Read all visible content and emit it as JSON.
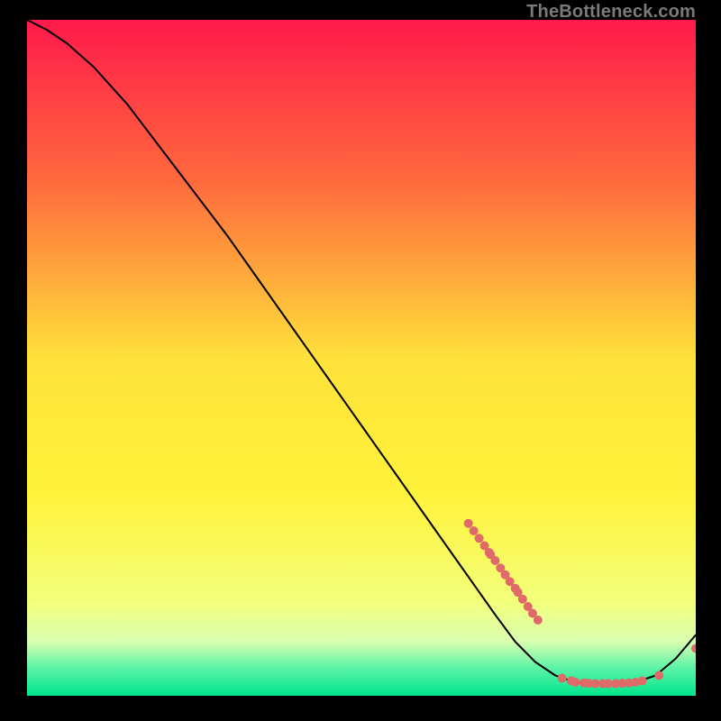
{
  "watermark": "TheBottleneck.com",
  "chart_data": {
    "type": "line",
    "title": "",
    "xlabel": "",
    "ylabel": "",
    "xlim": [
      0,
      100
    ],
    "ylim": [
      0,
      100
    ],
    "background_gradient": {
      "top": "#ff1a4b",
      "mid_upper": "#ff7a3a",
      "mid": "#ffe13a",
      "mid_lower": "#f7ff66",
      "green_band_top": "#d8ffb0",
      "green_band_mid": "#59f3a6",
      "bottom": "#00e58a"
    },
    "curve": {
      "name": "bottleneck-curve",
      "color": "#000000",
      "points_xy": [
        [
          0,
          100
        ],
        [
          3,
          98.5
        ],
        [
          6,
          96.5
        ],
        [
          10,
          93
        ],
        [
          15,
          87.5
        ],
        [
          20,
          81
        ],
        [
          25,
          74.5
        ],
        [
          30,
          68
        ],
        [
          35,
          61
        ],
        [
          40,
          54
        ],
        [
          45,
          47
        ],
        [
          50,
          40
        ],
        [
          55,
          33
        ],
        [
          60,
          26
        ],
        [
          65,
          19
        ],
        [
          70,
          12
        ],
        [
          73,
          8
        ],
        [
          76,
          5
        ],
        [
          79,
          3
        ],
        [
          82,
          2
        ],
        [
          85,
          1.8
        ],
        [
          88,
          1.8
        ],
        [
          91,
          2
        ],
        [
          94,
          3
        ],
        [
          97,
          5.5
        ],
        [
          100,
          9
        ]
      ]
    },
    "highlight_dots": {
      "color": "#e06a6a",
      "radius": 5,
      "points_xy": [
        [
          66,
          25.5
        ],
        [
          66.8,
          24.4
        ],
        [
          67.6,
          23.3
        ],
        [
          68.4,
          22.2
        ],
        [
          69.1,
          21.2
        ],
        [
          69.3,
          20.9
        ],
        [
          70.0,
          20.0
        ],
        [
          70.8,
          18.9
        ],
        [
          71.5,
          17.9
        ],
        [
          72.2,
          16.9
        ],
        [
          73.0,
          15.9
        ],
        [
          73.4,
          15.3
        ],
        [
          74.1,
          14.3
        ],
        [
          74.9,
          13.2
        ],
        [
          75.6,
          12.2
        ],
        [
          76.4,
          11.2
        ],
        [
          80.0,
          2.6
        ],
        [
          81.4,
          2.2
        ],
        [
          82.0,
          2.0
        ],
        [
          83.3,
          1.9
        ],
        [
          84.0,
          1.85
        ],
        [
          85.0,
          1.8
        ],
        [
          86.1,
          1.8
        ],
        [
          86.9,
          1.8
        ],
        [
          88.0,
          1.8
        ],
        [
          89.0,
          1.85
        ],
        [
          90.0,
          1.9
        ],
        [
          91.0,
          2.0
        ],
        [
          92.0,
          2.2
        ],
        [
          94.5,
          3.0
        ],
        [
          100,
          7.0
        ]
      ]
    }
  }
}
